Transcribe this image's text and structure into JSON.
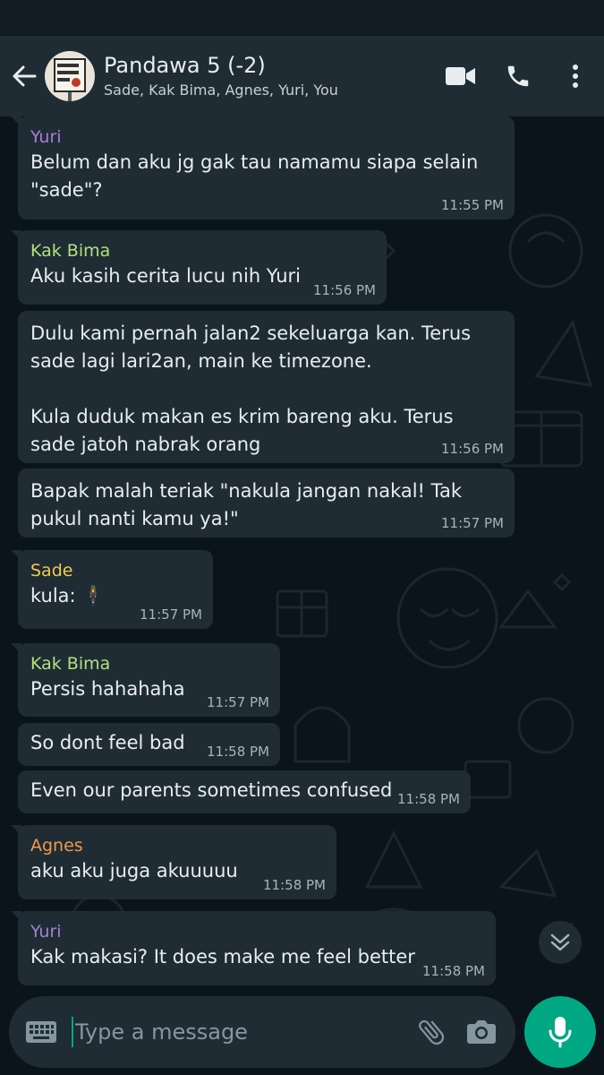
{
  "header": {
    "title": "Pandawa 5 (-2)",
    "subtitle": "Sade, Kak Bima, Agnes, Yuri, You",
    "avatar_text": "10 YANG SALAH 10 YANG BENAR"
  },
  "colors": {
    "header_bg": "#1f2c34",
    "chat_bg": "#0b141a",
    "bubble_bg": "#1f2c34",
    "accent": "#00a884",
    "yuri": "#a77ed6",
    "bima": "#b4e07c",
    "sade": "#f2c94c",
    "agnes": "#f2994a"
  },
  "messages": [
    {
      "sender": "Yuri",
      "text": "Belum dan aku jg gak tau namamu siapa selain \"sade\"?",
      "time": "11:55 PM"
    },
    {
      "sender": "Kak Bima",
      "text": "Aku kasih cerita lucu nih Yuri",
      "time": "11:56 PM"
    },
    {
      "sender": "",
      "text": "Dulu kami pernah jalan2 sekeluarga kan. Terus sade lagi lari2an, main ke timezone.\n\nKula duduk makan es krim bareng aku. Terus sade jatoh nabrak orang",
      "time": "11:56 PM"
    },
    {
      "sender": "",
      "text": "Bapak malah teriak \"nakula jangan nakal! Tak pukul nanti kamu ya!\"",
      "time": "11:57 PM"
    },
    {
      "sender": "Sade",
      "text": "kula:",
      "emoji": "🕴",
      "time": "11:57 PM"
    },
    {
      "sender": "Kak Bima",
      "text": "Persis hahahaha",
      "time": "11:57 PM"
    },
    {
      "sender": "",
      "text": "So dont feel bad",
      "time": "11:58 PM"
    },
    {
      "sender": "",
      "text": "Even our parents sometimes confused",
      "time": "11:58 PM"
    },
    {
      "sender": "Agnes",
      "text": "aku aku juga akuuuuu",
      "time": "11:58 PM"
    },
    {
      "sender": "Yuri",
      "text": "Kak makasi? It does make me feel better",
      "time": "11:58 PM"
    }
  ],
  "composer": {
    "placeholder": "Type a message"
  }
}
